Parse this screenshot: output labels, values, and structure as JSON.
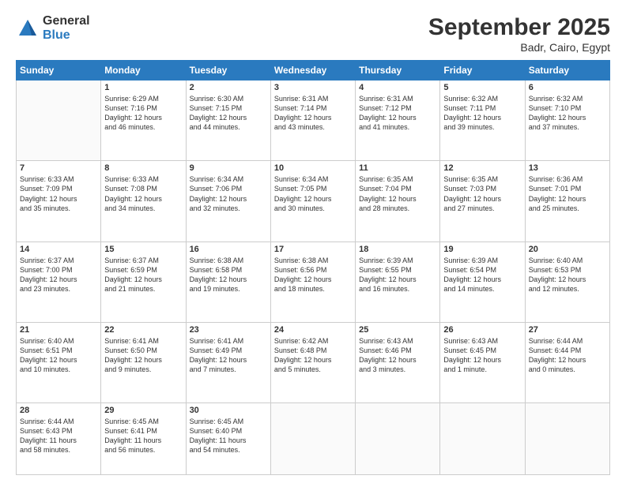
{
  "header": {
    "logo_general": "General",
    "logo_blue": "Blue",
    "title": "September 2025",
    "location": "Badr, Cairo, Egypt"
  },
  "days_of_week": [
    "Sunday",
    "Monday",
    "Tuesday",
    "Wednesday",
    "Thursday",
    "Friday",
    "Saturday"
  ],
  "weeks": [
    [
      {
        "num": "",
        "info": ""
      },
      {
        "num": "1",
        "info": "Sunrise: 6:29 AM\nSunset: 7:16 PM\nDaylight: 12 hours\nand 46 minutes."
      },
      {
        "num": "2",
        "info": "Sunrise: 6:30 AM\nSunset: 7:15 PM\nDaylight: 12 hours\nand 44 minutes."
      },
      {
        "num": "3",
        "info": "Sunrise: 6:31 AM\nSunset: 7:14 PM\nDaylight: 12 hours\nand 43 minutes."
      },
      {
        "num": "4",
        "info": "Sunrise: 6:31 AM\nSunset: 7:12 PM\nDaylight: 12 hours\nand 41 minutes."
      },
      {
        "num": "5",
        "info": "Sunrise: 6:32 AM\nSunset: 7:11 PM\nDaylight: 12 hours\nand 39 minutes."
      },
      {
        "num": "6",
        "info": "Sunrise: 6:32 AM\nSunset: 7:10 PM\nDaylight: 12 hours\nand 37 minutes."
      }
    ],
    [
      {
        "num": "7",
        "info": "Sunrise: 6:33 AM\nSunset: 7:09 PM\nDaylight: 12 hours\nand 35 minutes."
      },
      {
        "num": "8",
        "info": "Sunrise: 6:33 AM\nSunset: 7:08 PM\nDaylight: 12 hours\nand 34 minutes."
      },
      {
        "num": "9",
        "info": "Sunrise: 6:34 AM\nSunset: 7:06 PM\nDaylight: 12 hours\nand 32 minutes."
      },
      {
        "num": "10",
        "info": "Sunrise: 6:34 AM\nSunset: 7:05 PM\nDaylight: 12 hours\nand 30 minutes."
      },
      {
        "num": "11",
        "info": "Sunrise: 6:35 AM\nSunset: 7:04 PM\nDaylight: 12 hours\nand 28 minutes."
      },
      {
        "num": "12",
        "info": "Sunrise: 6:35 AM\nSunset: 7:03 PM\nDaylight: 12 hours\nand 27 minutes."
      },
      {
        "num": "13",
        "info": "Sunrise: 6:36 AM\nSunset: 7:01 PM\nDaylight: 12 hours\nand 25 minutes."
      }
    ],
    [
      {
        "num": "14",
        "info": "Sunrise: 6:37 AM\nSunset: 7:00 PM\nDaylight: 12 hours\nand 23 minutes."
      },
      {
        "num": "15",
        "info": "Sunrise: 6:37 AM\nSunset: 6:59 PM\nDaylight: 12 hours\nand 21 minutes."
      },
      {
        "num": "16",
        "info": "Sunrise: 6:38 AM\nSunset: 6:58 PM\nDaylight: 12 hours\nand 19 minutes."
      },
      {
        "num": "17",
        "info": "Sunrise: 6:38 AM\nSunset: 6:56 PM\nDaylight: 12 hours\nand 18 minutes."
      },
      {
        "num": "18",
        "info": "Sunrise: 6:39 AM\nSunset: 6:55 PM\nDaylight: 12 hours\nand 16 minutes."
      },
      {
        "num": "19",
        "info": "Sunrise: 6:39 AM\nSunset: 6:54 PM\nDaylight: 12 hours\nand 14 minutes."
      },
      {
        "num": "20",
        "info": "Sunrise: 6:40 AM\nSunset: 6:53 PM\nDaylight: 12 hours\nand 12 minutes."
      }
    ],
    [
      {
        "num": "21",
        "info": "Sunrise: 6:40 AM\nSunset: 6:51 PM\nDaylight: 12 hours\nand 10 minutes."
      },
      {
        "num": "22",
        "info": "Sunrise: 6:41 AM\nSunset: 6:50 PM\nDaylight: 12 hours\nand 9 minutes."
      },
      {
        "num": "23",
        "info": "Sunrise: 6:41 AM\nSunset: 6:49 PM\nDaylight: 12 hours\nand 7 minutes."
      },
      {
        "num": "24",
        "info": "Sunrise: 6:42 AM\nSunset: 6:48 PM\nDaylight: 12 hours\nand 5 minutes."
      },
      {
        "num": "25",
        "info": "Sunrise: 6:43 AM\nSunset: 6:46 PM\nDaylight: 12 hours\nand 3 minutes."
      },
      {
        "num": "26",
        "info": "Sunrise: 6:43 AM\nSunset: 6:45 PM\nDaylight: 12 hours\nand 1 minute."
      },
      {
        "num": "27",
        "info": "Sunrise: 6:44 AM\nSunset: 6:44 PM\nDaylight: 12 hours\nand 0 minutes."
      }
    ],
    [
      {
        "num": "28",
        "info": "Sunrise: 6:44 AM\nSunset: 6:43 PM\nDaylight: 11 hours\nand 58 minutes."
      },
      {
        "num": "29",
        "info": "Sunrise: 6:45 AM\nSunset: 6:41 PM\nDaylight: 11 hours\nand 56 minutes."
      },
      {
        "num": "30",
        "info": "Sunrise: 6:45 AM\nSunset: 6:40 PM\nDaylight: 11 hours\nand 54 minutes."
      },
      {
        "num": "",
        "info": ""
      },
      {
        "num": "",
        "info": ""
      },
      {
        "num": "",
        "info": ""
      },
      {
        "num": "",
        "info": ""
      }
    ]
  ]
}
